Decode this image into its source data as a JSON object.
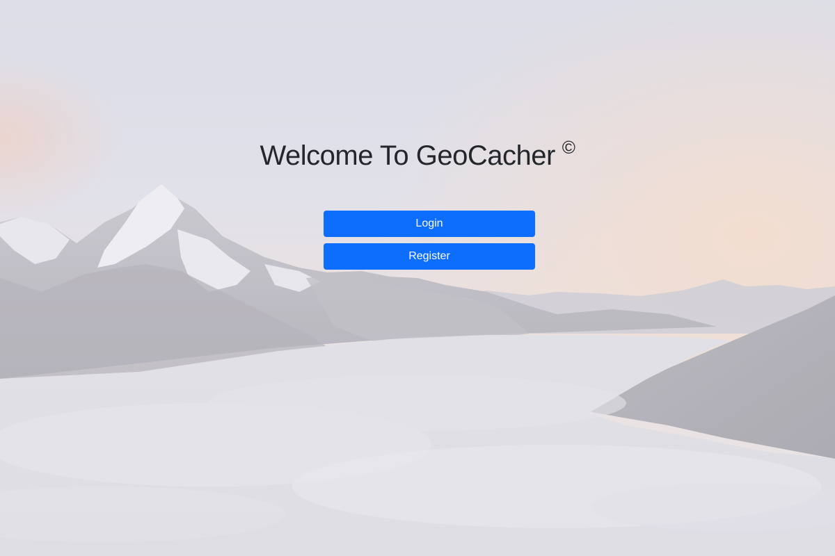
{
  "header": {
    "title": "Welcome To GeoCacher",
    "copyright_symbol": "©"
  },
  "actions": {
    "login_label": "Login",
    "register_label": "Register"
  },
  "colors": {
    "button": "#0d6efd",
    "button_text": "#ffffff",
    "title_text": "#23262b"
  },
  "background": {
    "description_icon": "mountain-landscape-background"
  }
}
